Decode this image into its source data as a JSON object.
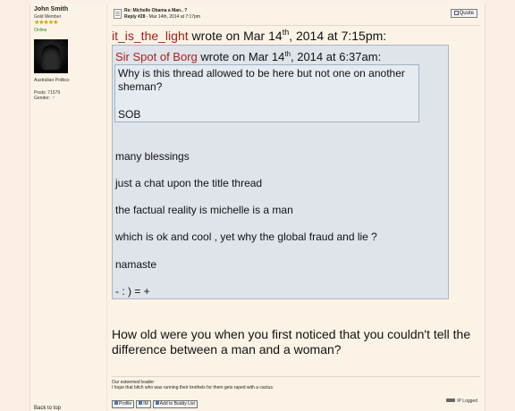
{
  "poster": {
    "name": "John Smith",
    "rank": "Gold Member",
    "stars": "★★★★★",
    "status": "Online",
    "title": "Australian Politics",
    "posts": "Posts: 71579",
    "gender_label": "Gender:",
    "gender_sign": "♂"
  },
  "post": {
    "subject": "Re: Michelle Obama a Man.. ?",
    "reply_label": "Reply #28",
    "reply_date": " - Mar 14th, 2014 at 7:17pm",
    "quote_button": "Quote"
  },
  "outer_quote": {
    "author": "it_is_the_light",
    "wrote": " wrote on Mar 14",
    "sup": "th",
    "time": ", 2014 at 7:15pm:"
  },
  "inner_quote": {
    "author": "Sir Spot of Borg",
    "wrote": " wrote on Mar 14",
    "sup": "th",
    "time": ", 2014 at 6:37am:",
    "text": "Why is this thread allowed to be here but not one on another sheman?",
    "sign": "SOB"
  },
  "quote_lines": [
    "many blessings",
    "just a chat upon the title thread",
    "the factual reality is michelle is a man",
    "which is ok and cool , yet why the global fraud and lie ?",
    "namaste",
    "- : ) = +"
  ],
  "reply": "How old were you when you first noticed that you couldn't tell the difference between a man and a woman?",
  "signature": {
    "line1": "Our esteemed leader:",
    "line2": "I hope that bitch who was running their brothels for them gets raped with a cactus."
  },
  "buttons": {
    "profile": "Profile",
    "im": "IM",
    "buddy": "Add to Buddy List"
  },
  "ip_logged": "IP Logged",
  "back_to_top": "Back to top"
}
